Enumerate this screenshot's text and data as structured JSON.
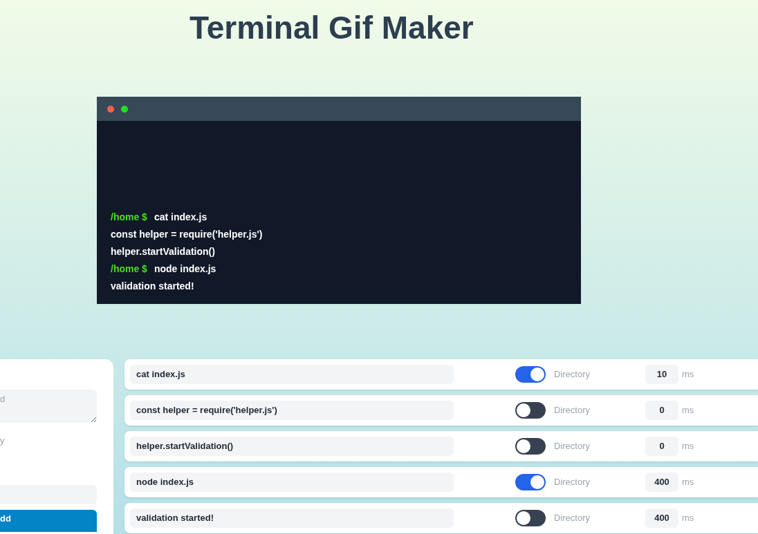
{
  "title": "Terminal Gif Maker",
  "terminal": {
    "lines": [
      {
        "kind": "command",
        "prompt": "/home $",
        "text": "cat index.js"
      },
      {
        "kind": "output",
        "text": "const helper = require('helper.js')"
      },
      {
        "kind": "output",
        "text": "helper.startValidation()"
      },
      {
        "kind": "command",
        "prompt": "/home $",
        "text": "node index.js"
      },
      {
        "kind": "output",
        "text": "validation started!"
      }
    ]
  },
  "form": {
    "textarea_placeholder": "d",
    "label": "y",
    "button": "dd"
  },
  "steps": [
    {
      "command": "cat index.js",
      "directory": true,
      "directory_label": "Directory",
      "delay": "10",
      "unit": "ms"
    },
    {
      "command": "const helper = require('helper.js')",
      "directory": false,
      "directory_label": "Directory",
      "delay": "0",
      "unit": "ms"
    },
    {
      "command": "helper.startValidation()",
      "directory": false,
      "directory_label": "Directory",
      "delay": "0",
      "unit": "ms"
    },
    {
      "command": "node index.js",
      "directory": true,
      "directory_label": "Directory",
      "delay": "400",
      "unit": "ms"
    },
    {
      "command": "validation started!",
      "directory": false,
      "directory_label": "Directory",
      "delay": "400",
      "unit": "ms"
    }
  ]
}
